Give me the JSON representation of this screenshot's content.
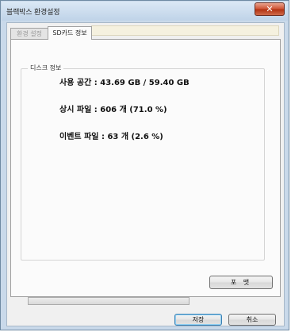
{
  "window": {
    "title": "블랙박스 환경설정",
    "close_label": "✕"
  },
  "tabs": [
    {
      "label": "환경 설정",
      "active": false
    },
    {
      "label": "SD카드 정보",
      "active": true
    }
  ],
  "disk_info": {
    "group_label": "디스크 정보",
    "used_space": "사용 공간 : 43.69 GB / 59.40 GB",
    "normal_files": "상시 파일 : 606 개 (71.0 %)",
    "event_files": "이벤트 파일 : 63 개 (2.6 %)"
  },
  "format": {
    "progress": 0.0,
    "button_label": "포 맷"
  },
  "footer": {
    "save_label": "저장",
    "cancel_label": "취소"
  },
  "colors": {
    "titlebar": "#c9d9ea",
    "close_button": "#c8492a",
    "tab_band": "#f5f1df"
  }
}
